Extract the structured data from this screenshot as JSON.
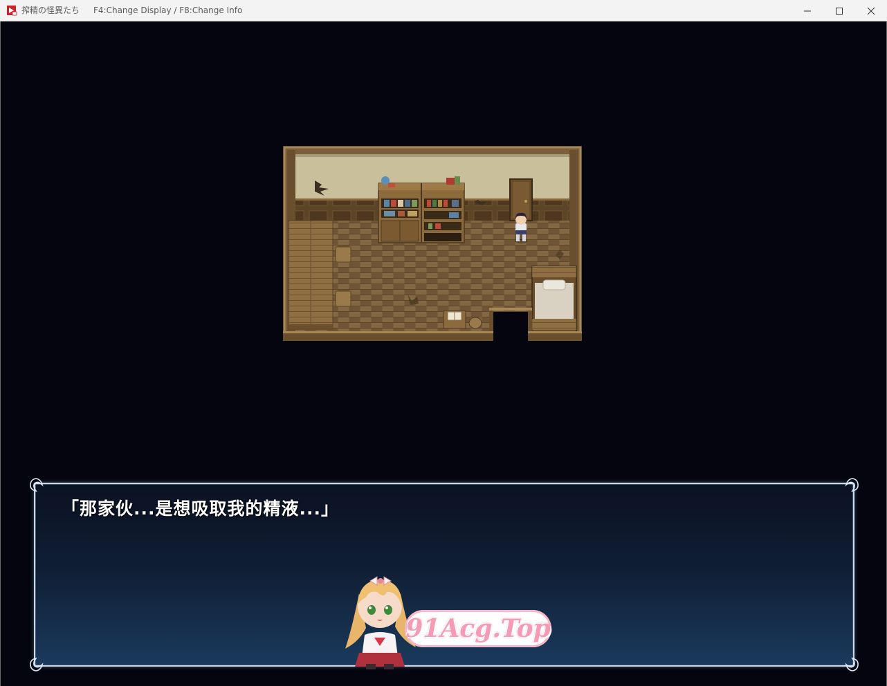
{
  "window": {
    "title": "搾精の怪異たち",
    "info": "F4:Change Display / F8:Change Info",
    "controls": {
      "minimize_icon": "minimize-icon",
      "maximize_icon": "maximize-icon",
      "close_icon": "close-icon"
    }
  },
  "scene": {
    "map": "bedroom-interior",
    "player_sprite": "schoolboy-character"
  },
  "message": {
    "text": "「那家伙...是想吸取我的精液...」"
  },
  "watermark": {
    "text": "91Acg.Top",
    "colors": {
      "text": "#f59bb6",
      "pill": "#ffffff"
    }
  },
  "colors": {
    "background": "#04050f",
    "message_border": "#c9d8ea",
    "message_bg_top": "#0b1222",
    "message_bg_bottom": "#1a3a5c"
  }
}
